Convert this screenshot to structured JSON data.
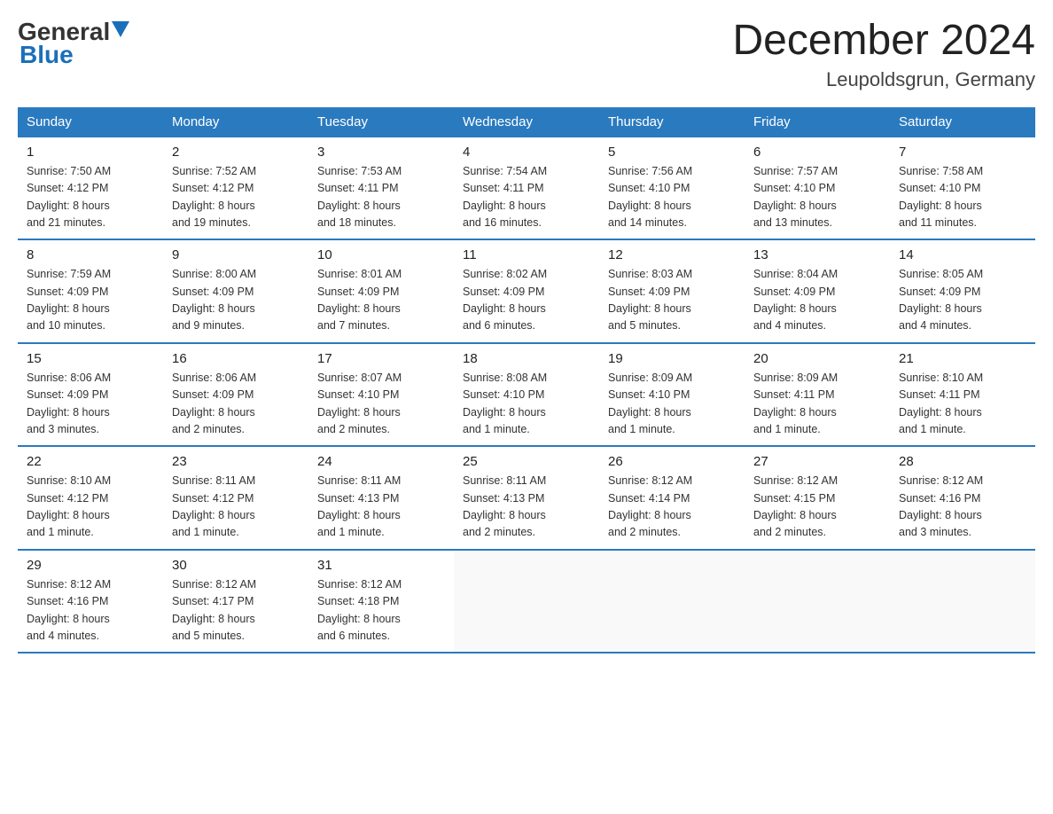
{
  "header": {
    "logo_general": "General",
    "logo_blue": "Blue",
    "month_title": "December 2024",
    "location": "Leupoldsgrun, Germany"
  },
  "weekdays": [
    "Sunday",
    "Monday",
    "Tuesday",
    "Wednesday",
    "Thursday",
    "Friday",
    "Saturday"
  ],
  "weeks": [
    [
      {
        "day": "1",
        "sunrise": "7:50 AM",
        "sunset": "4:12 PM",
        "daylight": "8 hours and 21 minutes."
      },
      {
        "day": "2",
        "sunrise": "7:52 AM",
        "sunset": "4:12 PM",
        "daylight": "8 hours and 19 minutes."
      },
      {
        "day": "3",
        "sunrise": "7:53 AM",
        "sunset": "4:11 PM",
        "daylight": "8 hours and 18 minutes."
      },
      {
        "day": "4",
        "sunrise": "7:54 AM",
        "sunset": "4:11 PM",
        "daylight": "8 hours and 16 minutes."
      },
      {
        "day": "5",
        "sunrise": "7:56 AM",
        "sunset": "4:10 PM",
        "daylight": "8 hours and 14 minutes."
      },
      {
        "day": "6",
        "sunrise": "7:57 AM",
        "sunset": "4:10 PM",
        "daylight": "8 hours and 13 minutes."
      },
      {
        "day": "7",
        "sunrise": "7:58 AM",
        "sunset": "4:10 PM",
        "daylight": "8 hours and 11 minutes."
      }
    ],
    [
      {
        "day": "8",
        "sunrise": "7:59 AM",
        "sunset": "4:09 PM",
        "daylight": "8 hours and 10 minutes."
      },
      {
        "day": "9",
        "sunrise": "8:00 AM",
        "sunset": "4:09 PM",
        "daylight": "8 hours and 9 minutes."
      },
      {
        "day": "10",
        "sunrise": "8:01 AM",
        "sunset": "4:09 PM",
        "daylight": "8 hours and 7 minutes."
      },
      {
        "day": "11",
        "sunrise": "8:02 AM",
        "sunset": "4:09 PM",
        "daylight": "8 hours and 6 minutes."
      },
      {
        "day": "12",
        "sunrise": "8:03 AM",
        "sunset": "4:09 PM",
        "daylight": "8 hours and 5 minutes."
      },
      {
        "day": "13",
        "sunrise": "8:04 AM",
        "sunset": "4:09 PM",
        "daylight": "8 hours and 4 minutes."
      },
      {
        "day": "14",
        "sunrise": "8:05 AM",
        "sunset": "4:09 PM",
        "daylight": "8 hours and 4 minutes."
      }
    ],
    [
      {
        "day": "15",
        "sunrise": "8:06 AM",
        "sunset": "4:09 PM",
        "daylight": "8 hours and 3 minutes."
      },
      {
        "day": "16",
        "sunrise": "8:06 AM",
        "sunset": "4:09 PM",
        "daylight": "8 hours and 2 minutes."
      },
      {
        "day": "17",
        "sunrise": "8:07 AM",
        "sunset": "4:10 PM",
        "daylight": "8 hours and 2 minutes."
      },
      {
        "day": "18",
        "sunrise": "8:08 AM",
        "sunset": "4:10 PM",
        "daylight": "8 hours and 1 minute."
      },
      {
        "day": "19",
        "sunrise": "8:09 AM",
        "sunset": "4:10 PM",
        "daylight": "8 hours and 1 minute."
      },
      {
        "day": "20",
        "sunrise": "8:09 AM",
        "sunset": "4:11 PM",
        "daylight": "8 hours and 1 minute."
      },
      {
        "day": "21",
        "sunrise": "8:10 AM",
        "sunset": "4:11 PM",
        "daylight": "8 hours and 1 minute."
      }
    ],
    [
      {
        "day": "22",
        "sunrise": "8:10 AM",
        "sunset": "4:12 PM",
        "daylight": "8 hours and 1 minute."
      },
      {
        "day": "23",
        "sunrise": "8:11 AM",
        "sunset": "4:12 PM",
        "daylight": "8 hours and 1 minute."
      },
      {
        "day": "24",
        "sunrise": "8:11 AM",
        "sunset": "4:13 PM",
        "daylight": "8 hours and 1 minute."
      },
      {
        "day": "25",
        "sunrise": "8:11 AM",
        "sunset": "4:13 PM",
        "daylight": "8 hours and 2 minutes."
      },
      {
        "day": "26",
        "sunrise": "8:12 AM",
        "sunset": "4:14 PM",
        "daylight": "8 hours and 2 minutes."
      },
      {
        "day": "27",
        "sunrise": "8:12 AM",
        "sunset": "4:15 PM",
        "daylight": "8 hours and 2 minutes."
      },
      {
        "day": "28",
        "sunrise": "8:12 AM",
        "sunset": "4:16 PM",
        "daylight": "8 hours and 3 minutes."
      }
    ],
    [
      {
        "day": "29",
        "sunrise": "8:12 AM",
        "sunset": "4:16 PM",
        "daylight": "8 hours and 4 minutes."
      },
      {
        "day": "30",
        "sunrise": "8:12 AM",
        "sunset": "4:17 PM",
        "daylight": "8 hours and 5 minutes."
      },
      {
        "day": "31",
        "sunrise": "8:12 AM",
        "sunset": "4:18 PM",
        "daylight": "8 hours and 6 minutes."
      },
      null,
      null,
      null,
      null
    ]
  ],
  "labels": {
    "sunrise": "Sunrise:",
    "sunset": "Sunset:",
    "daylight": "Daylight:"
  }
}
